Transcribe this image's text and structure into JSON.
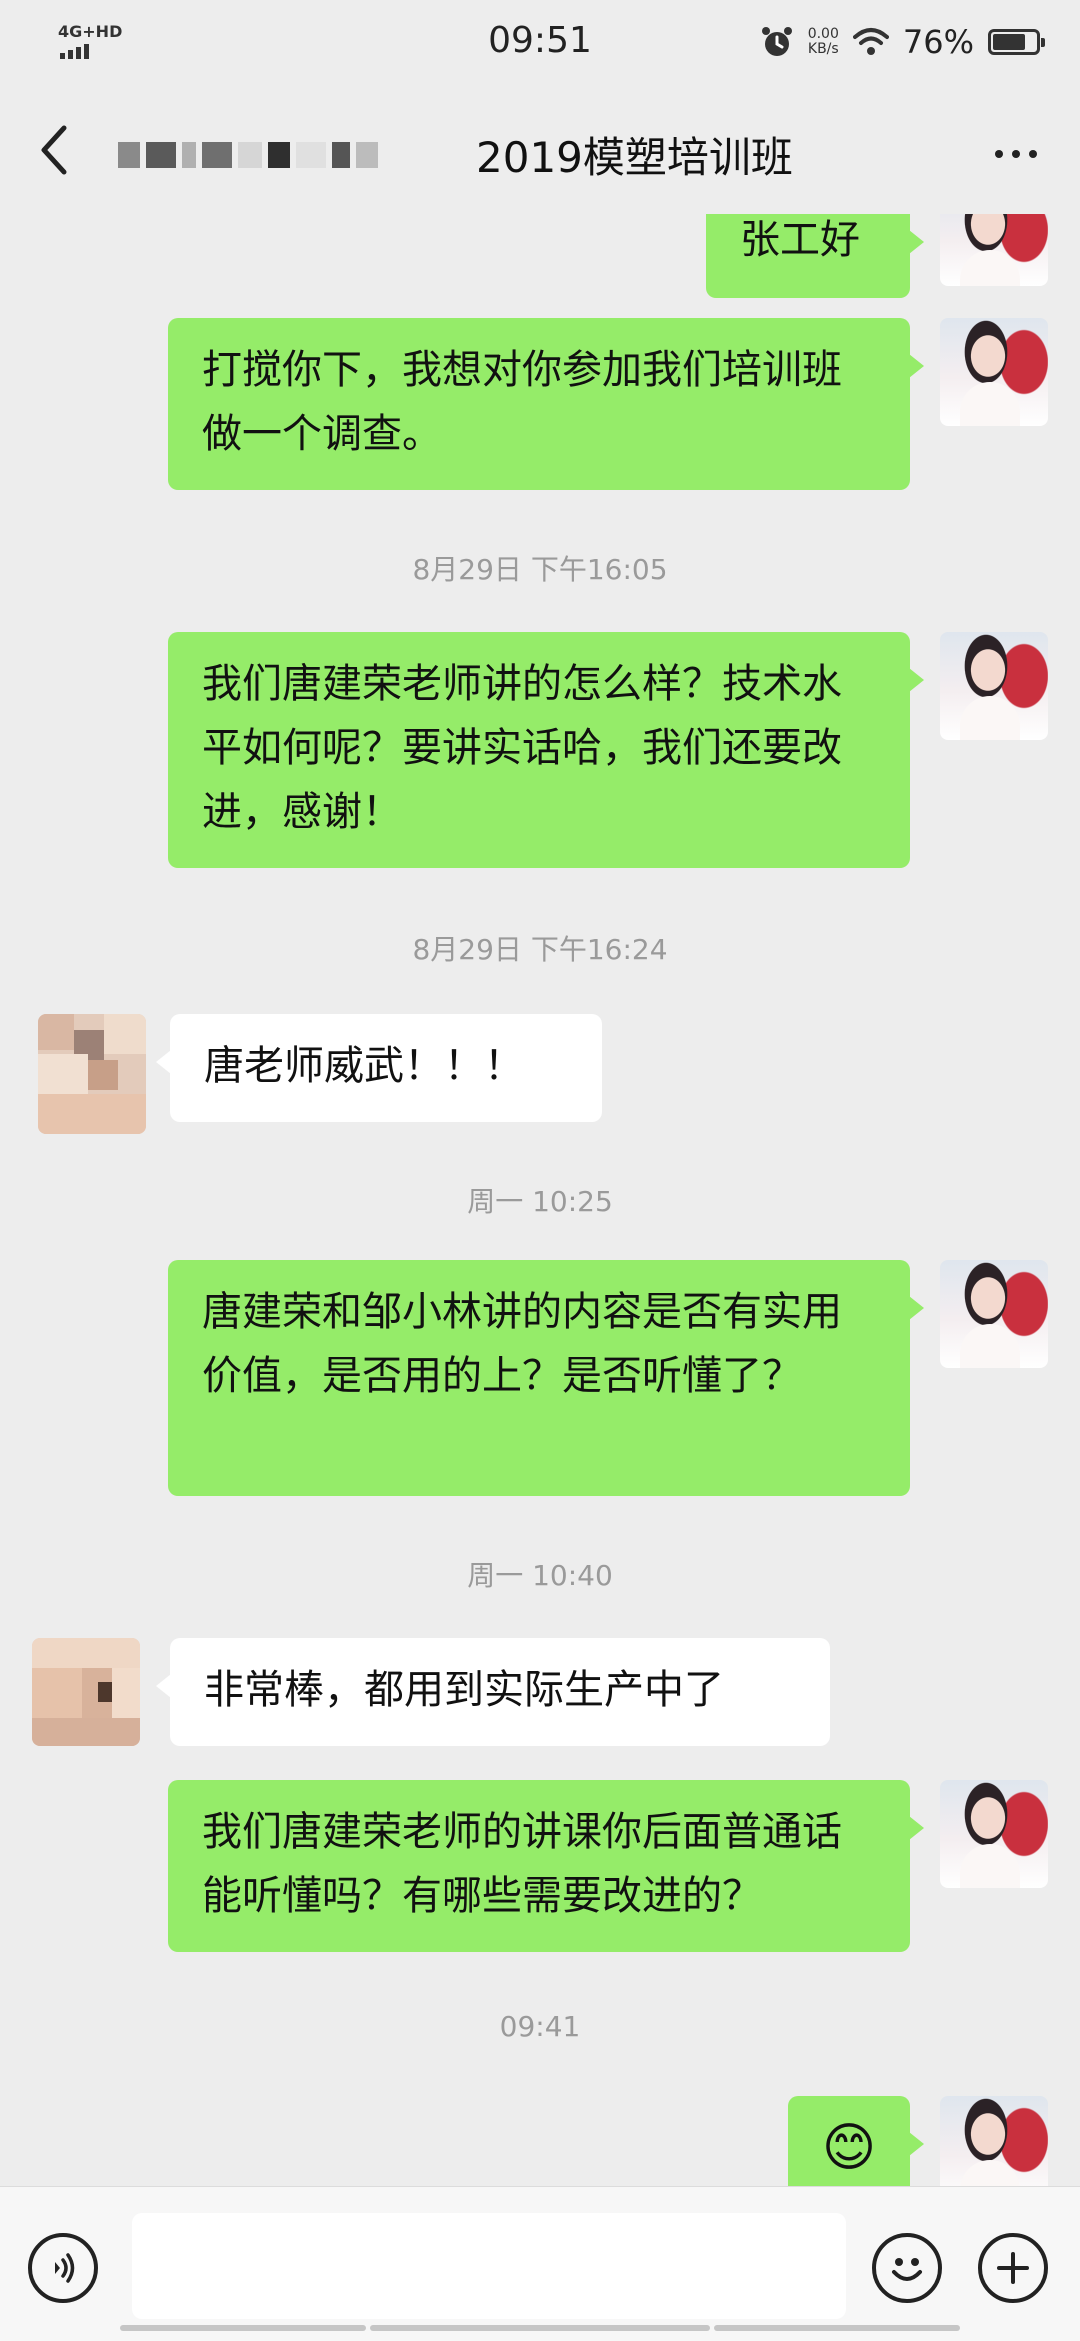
{
  "status_bar": {
    "network": "4G+HD",
    "time": "09:51",
    "speed_value": "0.00",
    "speed_unit": "KB/s",
    "battery_percent": "76%",
    "battery_level": 0.76
  },
  "header": {
    "title": "2019模塑培训班"
  },
  "messages": [
    {
      "kind": "mine",
      "text": "张工好"
    },
    {
      "kind": "mine",
      "text": "打搅你下，我想对你参加我们培训班做一个调查。"
    },
    {
      "kind": "time",
      "text": "8月29日 下午16:05"
    },
    {
      "kind": "mine",
      "text": "我们唐建荣老师讲的怎么样？技术水平如何呢？要讲实话哈，我们还要改进，感谢！"
    },
    {
      "kind": "time",
      "text": "8月29日 下午16:24"
    },
    {
      "kind": "other",
      "text": "唐老师威武！！！"
    },
    {
      "kind": "time",
      "text": "周一 10:25"
    },
    {
      "kind": "mine",
      "text": "唐建荣和邹小林讲的内容是否有实用价值，是否用的上？是否听懂了？"
    },
    {
      "kind": "time",
      "text": "周一 10:40"
    },
    {
      "kind": "other",
      "text": "非常棒，都用到实际生产中了"
    },
    {
      "kind": "mine",
      "text": "我们唐建荣老师的讲课你后面普通话能听懂吗？有哪些需要改进的？"
    },
    {
      "kind": "time",
      "text": "09:41"
    },
    {
      "kind": "mine",
      "text": "😊"
    }
  ],
  "icons": {
    "back": "chevron-left-icon",
    "more": "more-dots-icon",
    "voice": "voice-icon",
    "emoji": "emoji-icon",
    "plus": "plus-icon"
  },
  "colors": {
    "my_bubble": "#95ec69",
    "other_bubble": "#ffffff",
    "background": "#ededed"
  }
}
